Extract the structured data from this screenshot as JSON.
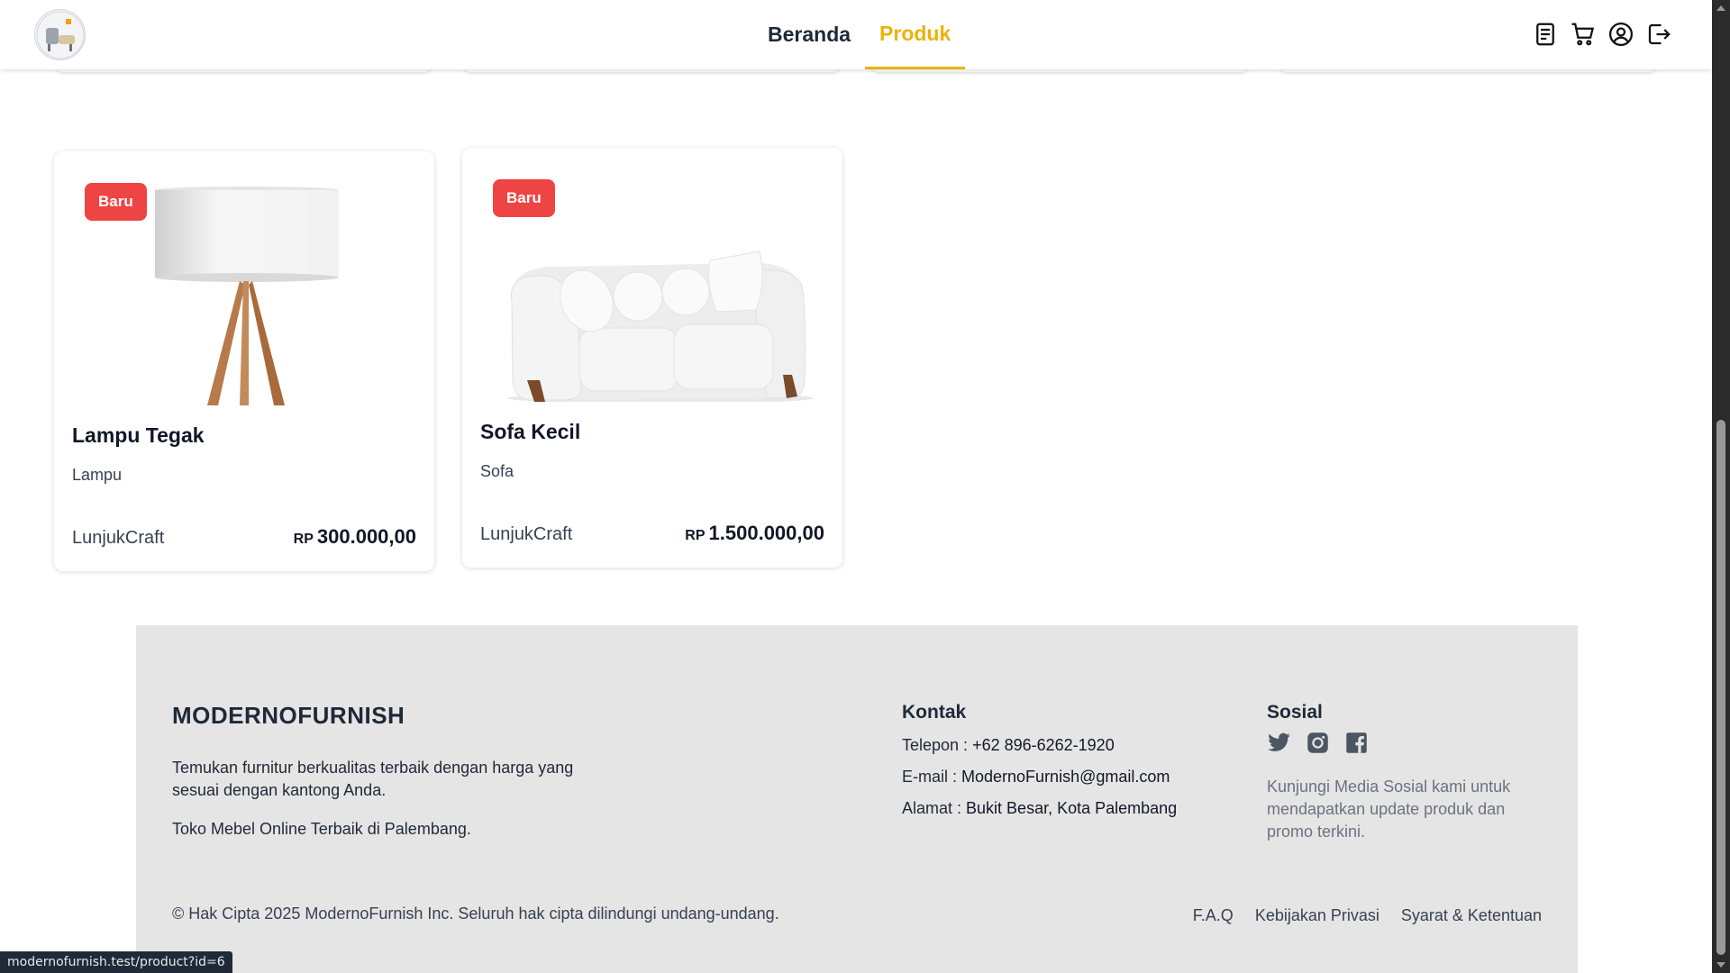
{
  "header": {
    "nav": [
      {
        "label": "Beranda",
        "active": false
      },
      {
        "label": "Produk",
        "active": true
      }
    ],
    "icons": [
      "receipt-icon",
      "cart-icon",
      "user-icon",
      "logout-icon"
    ],
    "accent_color": "#eab308"
  },
  "products": [
    {
      "badge": "Baru",
      "name": "Lampu Tegak",
      "category": "Lampu",
      "seller": "LunjukCraft",
      "currency": "RP",
      "price": "300.000,00"
    },
    {
      "badge": "Baru",
      "name": "Sofa Kecil",
      "category": "Sofa",
      "seller": "LunjukCraft",
      "currency": "RP",
      "price": "1.500.000,00"
    }
  ],
  "footer": {
    "brand": "MODERNOFURNISH",
    "description": "Temukan furnitur berkualitas terbaik dengan harga yang sesuai dengan kantong Anda.",
    "tagline": "Toko Mebel Online Terbaik di Palembang.",
    "contact": {
      "title": "Kontak",
      "phone_label": "Telepon : ",
      "phone": "+62 896-6262-1920",
      "email_label": "E-mail : ",
      "email": "ModernoFurnish@gmail.com",
      "address_label": "Alamat : ",
      "address": "Bukit Besar, Kota Palembang"
    },
    "social": {
      "title": "Sosial",
      "icons": [
        "twitter-icon",
        "instagram-icon",
        "facebook-icon"
      ],
      "description": "Kunjungi Media Sosial kami untuk mendapatkan update produk dan promo terkini."
    },
    "copyright": "© Hak Cipta 2025 ModernoFurnish Inc. Seluruh hak cipta dilindungi undang-undang.",
    "links": [
      "F.A.Q",
      "Kebijakan Privasi",
      "Syarat & Ketentuan"
    ]
  },
  "status_url": "modernofurnish.test/product?id=6",
  "badge_color": "#ef4444"
}
